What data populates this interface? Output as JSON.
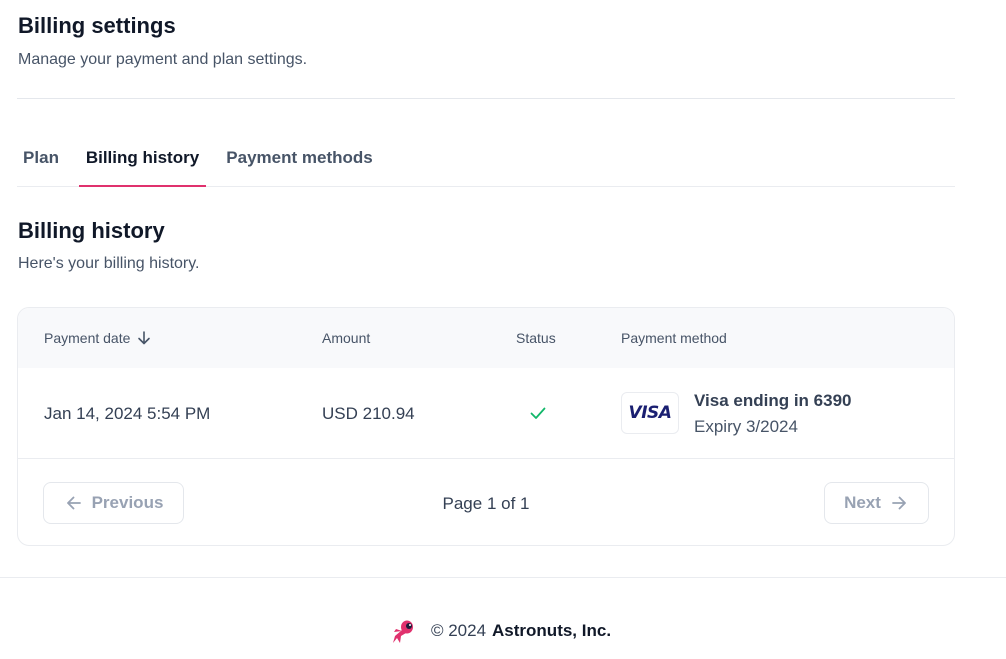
{
  "header": {
    "title": "Billing settings",
    "subtitle": "Manage your payment and plan settings."
  },
  "tabs": [
    {
      "label": "Plan",
      "active": false
    },
    {
      "label": "Billing history",
      "active": true
    },
    {
      "label": "Payment methods",
      "active": false
    }
  ],
  "section": {
    "title": "Billing history",
    "subtitle": "Here's your billing history."
  },
  "table": {
    "columns": [
      "Payment date",
      "Amount",
      "Status",
      "Payment method"
    ],
    "sort_icon": "arrow-down-icon",
    "rows": [
      {
        "date": "Jan 14, 2024 5:54 PM",
        "amount": "USD 210.94",
        "status_icon": "check-icon",
        "card_brand": "VISA",
        "card_label": "Visa ending in 6390",
        "card_expiry": "Expiry 3/2024"
      }
    ]
  },
  "pagination": {
    "previous_label": "Previous",
    "next_label": "Next",
    "page_text": "Page 1 of 1"
  },
  "footer": {
    "copyright": "© 2024",
    "company": "Astronuts, Inc."
  },
  "colors": {
    "accent": "#e0316d",
    "success": "#12b76a",
    "visa": "#1a1f71"
  }
}
